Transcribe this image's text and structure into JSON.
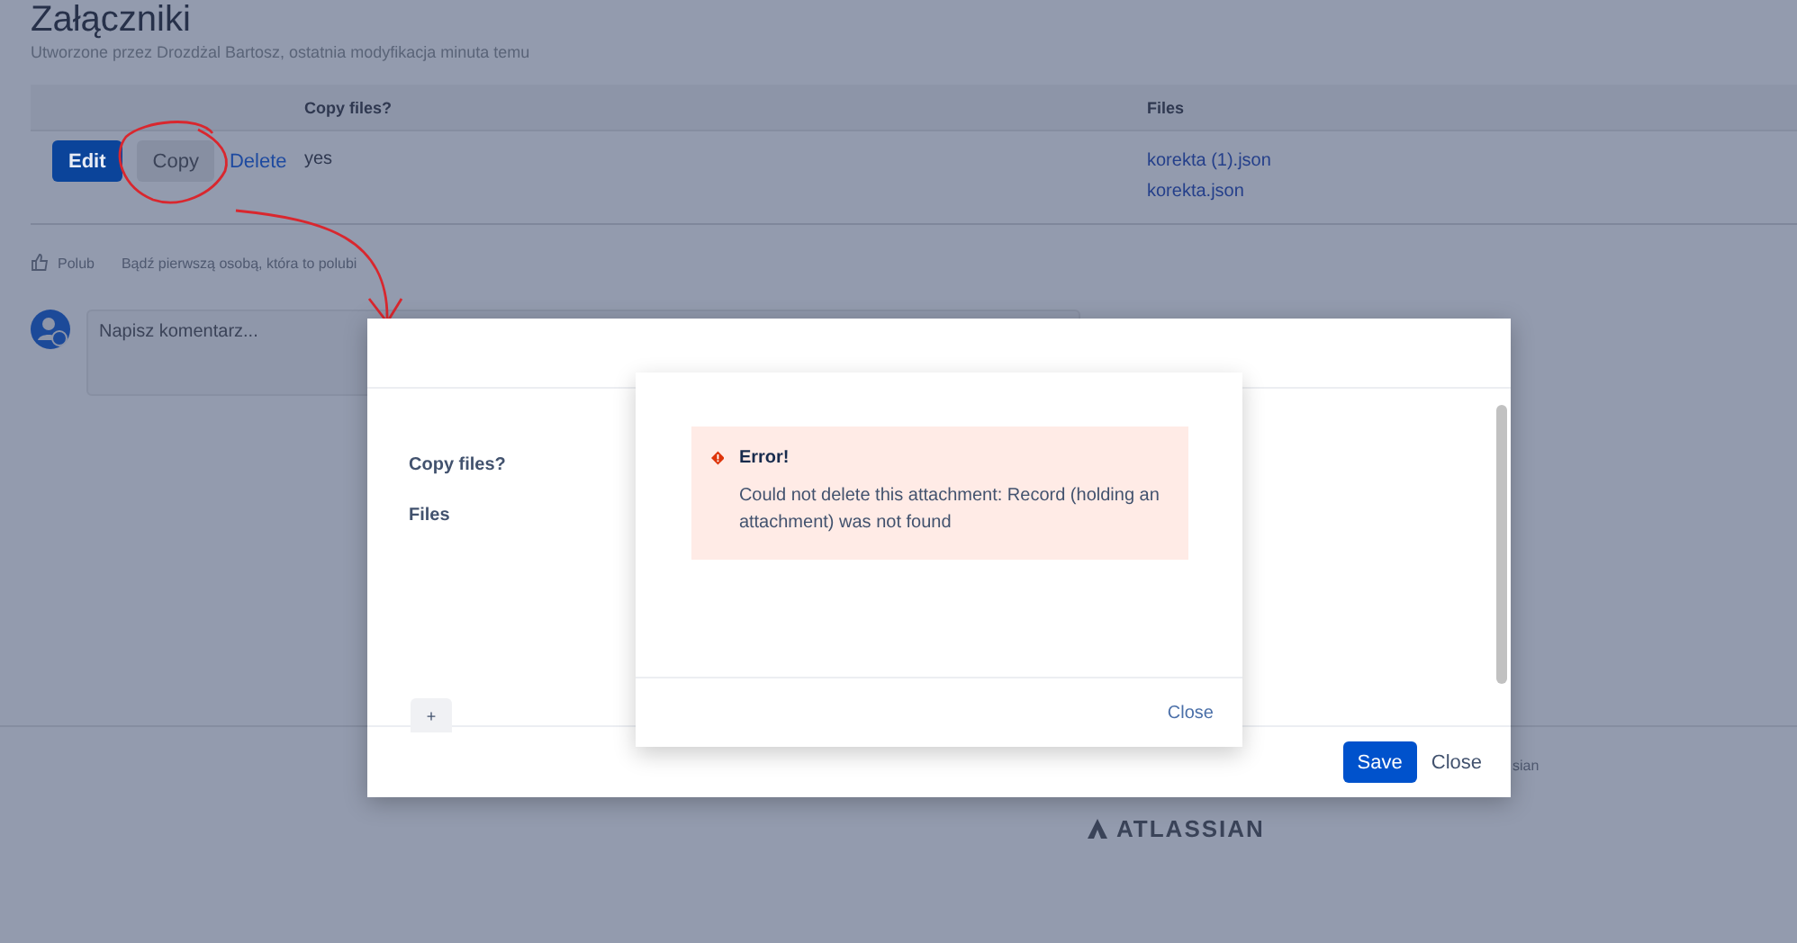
{
  "page": {
    "title": "Załączniki",
    "byline": "Utworzone przez Drozdżal Bartosz, ostatnia modyfikacja minuta temu",
    "table": {
      "columns": [
        "Copy files?",
        "Files"
      ],
      "rows": [
        {
          "actions": [
            {
              "label": "Edit",
              "kind": "primary"
            },
            {
              "label": "Copy",
              "kind": "default"
            },
            {
              "label": "Delete",
              "kind": "link"
            }
          ],
          "copy_files": "yes",
          "files": [
            "korekta (1).json",
            "korekta.json"
          ]
        }
      ]
    },
    "like": {
      "label": "Polub",
      "hint": "Bądź pierwszą osobą, która to polubi"
    },
    "comment": {
      "placeholder": "Napisz komentarz..."
    },
    "footer": {
      "text": "sian",
      "logo": "ATLASSIAN"
    }
  },
  "dialog": {
    "fields": [
      "Copy files?",
      "Files"
    ],
    "add_button": "+",
    "buttons": [
      {
        "label": "Save",
        "kind": "primary"
      },
      {
        "label": "Close",
        "kind": "link"
      }
    ]
  },
  "error_dialog": {
    "alert_title": "Error!",
    "alert_message": "Could not delete this attachment: Record (holding an attachment) was not found",
    "close": "Close"
  }
}
